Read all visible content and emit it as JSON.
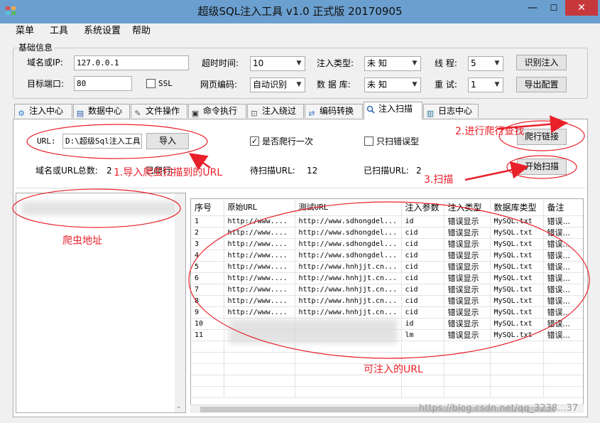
{
  "window": {
    "title": "超级SQL注入工具 v1.0 正式版 20170905",
    "minimize_glyph": "—",
    "maximize_glyph": "☐",
    "close_glyph": "✕"
  },
  "menu": {
    "items": [
      "菜单",
      "工具",
      "系统设置",
      "帮助"
    ]
  },
  "basic_info": {
    "group_title": "基础信息",
    "domain_label": "域名或IP:",
    "domain_value": "127.0.0.1",
    "port_label": "目标端口:",
    "port_value": "80",
    "ssl_label": "SSL",
    "timeout_label": "超时时间:",
    "timeout_value": "10",
    "encoding_label": "网页编码:",
    "encoding_value": "自动识别",
    "inject_type_label": "注入类型:",
    "inject_type_value": "未 知",
    "database_label": "数 据 库:",
    "database_value": "未 知",
    "threads_label": "线  程:",
    "threads_value": "5",
    "retry_label": "重  试:",
    "retry_value": "1",
    "identify_button": "识别注入",
    "export_button": "导出配置"
  },
  "tabs": [
    {
      "label": "注入中心",
      "icon": "gear-icon",
      "glyph": "⚙",
      "color": "#2a7fc9"
    },
    {
      "label": "数据中心",
      "icon": "database-icon",
      "glyph": "▤",
      "color": "#2a5fa8"
    },
    {
      "label": "文件操作",
      "icon": "file-edit-icon",
      "glyph": "✎",
      "color": "#5a5a5a"
    },
    {
      "label": "命令执行",
      "icon": "terminal-icon",
      "glyph": "▣",
      "color": "#333333"
    },
    {
      "label": "注入绕过",
      "icon": "bypass-icon",
      "glyph": "⊡",
      "color": "#555555"
    },
    {
      "label": "编码转换",
      "icon": "convert-icon",
      "glyph": "⇄",
      "color": "#3a7ac0"
    },
    {
      "label": "注入扫描",
      "icon": "search-icon",
      "glyph": "🔍",
      "color": "#3a6fb0"
    },
    {
      "label": "日志中心",
      "icon": "log-book-icon",
      "glyph": "▥",
      "color": "#2a7a9a"
    }
  ],
  "scan": {
    "url_label": "URL:",
    "url_value": "D:\\超级Sql注入工具",
    "import_button": "导入",
    "crawl_once_label": "是否爬行一次",
    "crawl_once_checked": true,
    "crawl_once_mark": "✓",
    "error_only_label": "只扫错误型",
    "crawl_button": "爬行链接",
    "start_button": "开始扫描",
    "total_label": "域名或URL总数:",
    "total_value": "2",
    "crawled_label": "已爬行:",
    "pending_label": "待扫描URL:",
    "pending_value": "12",
    "scanned_label": "已扫描URL:",
    "scanned_value": "2"
  },
  "grid": {
    "columns": [
      "序号",
      "原始URL",
      "测试URL",
      "注入参数",
      "注入类型",
      "数据库类型",
      "备注"
    ],
    "rows": [
      [
        "1",
        "http://www....",
        "http://www.sdhongdel...",
        "id",
        "错误显示",
        "MySQL.txt",
        "错误..."
      ],
      [
        "2",
        "http://www....",
        "http://www.sdhongdel...",
        "cid",
        "错误显示",
        "MySQL.txt",
        "错误..."
      ],
      [
        "3",
        "http://www....",
        "http://www.sdhongdel...",
        "cid",
        "错误显示",
        "MySQL.txt",
        "错误..."
      ],
      [
        "4",
        "http://www....",
        "http://www.sdhongdel...",
        "cid",
        "错误显示",
        "MySQL.txt",
        "错误..."
      ],
      [
        "5",
        "http://www....",
        "http://www.hnhjjt.cn...",
        "cid",
        "错误显示",
        "MySQL.txt",
        "错误..."
      ],
      [
        "6",
        "http://www....",
        "http://www.hnhjjt.cn...",
        "cid",
        "错误显示",
        "MySQL.txt",
        "错误..."
      ],
      [
        "7",
        "http://www....",
        "http://www.hnhjjt.cn...",
        "cid",
        "错误显示",
        "MySQL.txt",
        "错误..."
      ],
      [
        "8",
        "http://www....",
        "http://www.hnhjjt.cn...",
        "cid",
        "错误显示",
        "MySQL.txt",
        "错误..."
      ],
      [
        "9",
        "http://www....",
        "http://www.hnhjjt.cn...",
        "cid",
        "错误显示",
        "MySQL.txt",
        "错误..."
      ],
      [
        "10",
        "",
        "",
        "id",
        "错误显示",
        "MySQL.txt",
        "错误..."
      ],
      [
        "11",
        "",
        "",
        "lm",
        "错误显示",
        "MySQL.txt",
        "错误..."
      ]
    ]
  },
  "annotations": {
    "step1": "1.导入爬虫扫描到的URL",
    "step2": "2.进行爬行查找",
    "step3": "3.扫描",
    "crawler_address": "爬虫地址",
    "injectable_urls": "可注入的URL",
    "color": "#e8202a"
  },
  "watermark": "https://blog.csdn.net/qq_3238...37"
}
